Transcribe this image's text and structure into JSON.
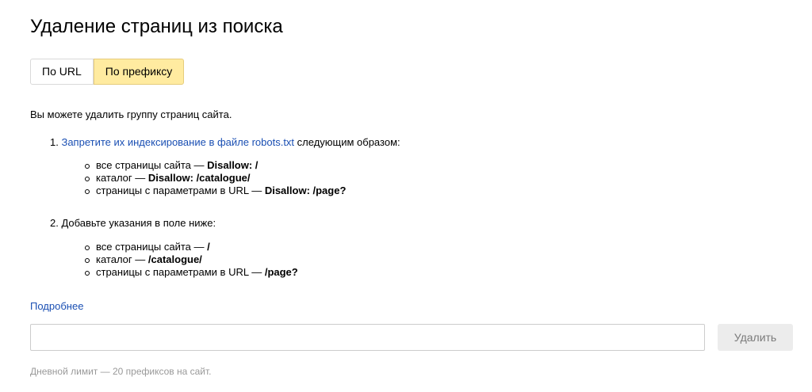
{
  "title": "Удаление страниц из поиска",
  "tabs": [
    {
      "label": "По URL",
      "active": false
    },
    {
      "label": "По префиксу",
      "active": true
    }
  ],
  "intro": "Вы можете удалить группу страниц сайта.",
  "step1": {
    "number": "1.",
    "link": "Запретите их индексирование в файле robots.txt",
    "rest": " следующим образом:",
    "items": [
      {
        "text": "все страницы сайта — ",
        "code": "Disallow: /"
      },
      {
        "text": "каталог — ",
        "code": "Disallow: /catalogue/"
      },
      {
        "text": "страницы с параметрами в URL — ",
        "code": "Disallow: /page?"
      }
    ]
  },
  "step2": {
    "number": "2.",
    "text": "Добавьте указания в поле ниже:",
    "items": [
      {
        "text": "все страницы сайта — ",
        "code": "/"
      },
      {
        "text": "каталог — ",
        "code": "/catalogue/"
      },
      {
        "text": "страницы с параметрами в URL — ",
        "code": "/page?"
      }
    ]
  },
  "more_link": "Подробнее",
  "input": {
    "value": "",
    "placeholder": ""
  },
  "delete_button": "Удалить",
  "limit_note": "Дневной лимит — 20 префиксов на сайт."
}
